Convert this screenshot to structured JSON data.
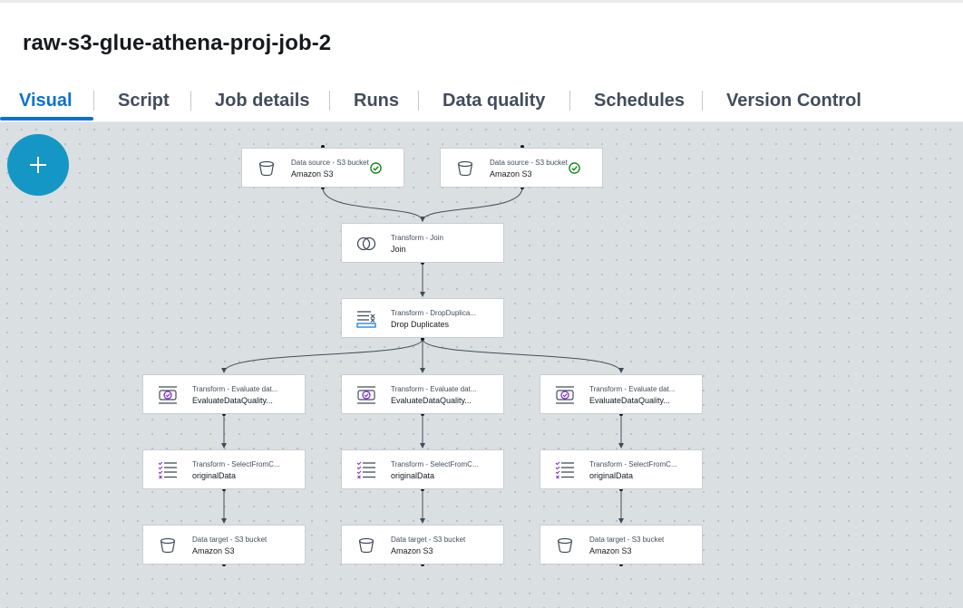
{
  "job": {
    "title": "raw-s3-glue-athena-proj-job-2"
  },
  "tabs": [
    {
      "label": "Visual"
    },
    {
      "label": "Script"
    },
    {
      "label": "Job details"
    },
    {
      "label": "Runs"
    },
    {
      "label": "Data quality"
    },
    {
      "label": "Schedules"
    },
    {
      "label": "Version Control"
    }
  ],
  "nodes": {
    "source1": {
      "type": "Data source - S3 bucket",
      "name": "Amazon S3",
      "icon": "bucket-icon",
      "status": "success-check-icon"
    },
    "source2": {
      "type": "Data source - S3 bucket",
      "name": "Amazon S3",
      "icon": "bucket-icon",
      "status": "success-check-icon"
    },
    "join": {
      "type": "Transform - Join",
      "name": "Join",
      "icon": "join-icon"
    },
    "dedup": {
      "type": "Transform - DropDuplica...",
      "name": "Drop Duplicates",
      "icon": "drop-duplicates-icon"
    },
    "dq1": {
      "type": "Transform - Evaluate dat...",
      "name": "EvaluateDataQuality...",
      "icon": "data-quality-icon"
    },
    "dq2": {
      "type": "Transform - Evaluate dat...",
      "name": "EvaluateDataQuality...",
      "icon": "data-quality-icon"
    },
    "dq3": {
      "type": "Transform - Evaluate dat...",
      "name": "EvaluateDataQuality...",
      "icon": "data-quality-icon"
    },
    "sel1": {
      "type": "Transform - SelectFromC...",
      "name": "originalData",
      "icon": "select-from-collection-icon"
    },
    "sel2": {
      "type": "Transform - SelectFromC...",
      "name": "originalData",
      "icon": "select-from-collection-icon"
    },
    "sel3": {
      "type": "Transform - SelectFromC...",
      "name": "originalData",
      "icon": "select-from-collection-icon"
    },
    "tgt1": {
      "type": "Data target - S3 bucket",
      "name": "Amazon S3",
      "icon": "bucket-icon"
    },
    "tgt2": {
      "type": "Data target - S3 bucket",
      "name": "Amazon S3",
      "icon": "bucket-icon"
    },
    "tgt3": {
      "type": "Data target - S3 bucket",
      "name": "Amazon S3",
      "icon": "bucket-icon"
    }
  },
  "colors": {
    "accent": "#0972d3",
    "add_button": "#1597c5",
    "success": "#037f0c",
    "transform_icon": "#7d2fd0"
  }
}
